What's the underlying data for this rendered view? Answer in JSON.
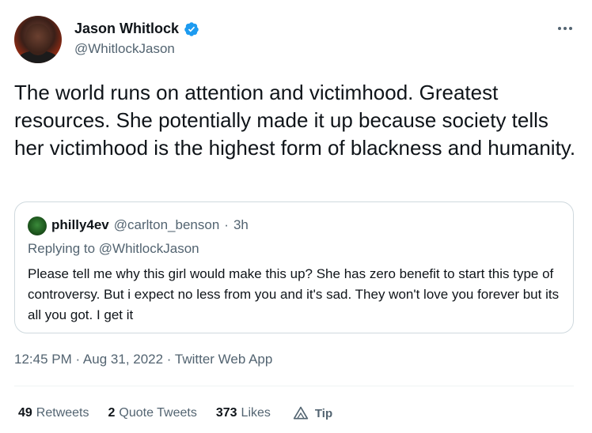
{
  "author": {
    "display_name": "Jason Whitlock",
    "handle": "@WhitlockJason",
    "verified_icon": "verified-badge-icon",
    "avatar_icon": "avatar-photo"
  },
  "menu_icon": "more-options-icon",
  "tweet": {
    "text": "The world runs on attention and victimhood. Greatest resources. She potentially made it up because society tells her victimhood is the highest form of blackness and humanity."
  },
  "quoted_tweet": {
    "display_name": "philly4ev",
    "handle": "@carlton_benson",
    "separator": "·",
    "time_ago": "3h",
    "replying_to": "Replying to @WhitlockJason",
    "text": "Please tell me why this girl would make this up? She has zero benefit to start this type of controversy. But i expect no less from you and it's sad. They won't love you forever but its all you got. I get it"
  },
  "meta": {
    "timestamp": "12:45 PM · Aug 31, 2022 · Twitter Web App"
  },
  "stats": {
    "retweets_count": "49",
    "retweets_label": "Retweets",
    "quotes_count": "2",
    "quotes_label": "Quote Tweets",
    "likes_count": "373",
    "likes_label": "Likes",
    "tip_label": "Tip"
  },
  "colors": {
    "text_primary": "#0f1419",
    "text_secondary": "#536471",
    "verified_blue": "#1d9bf0",
    "border": "#cfd9de"
  }
}
